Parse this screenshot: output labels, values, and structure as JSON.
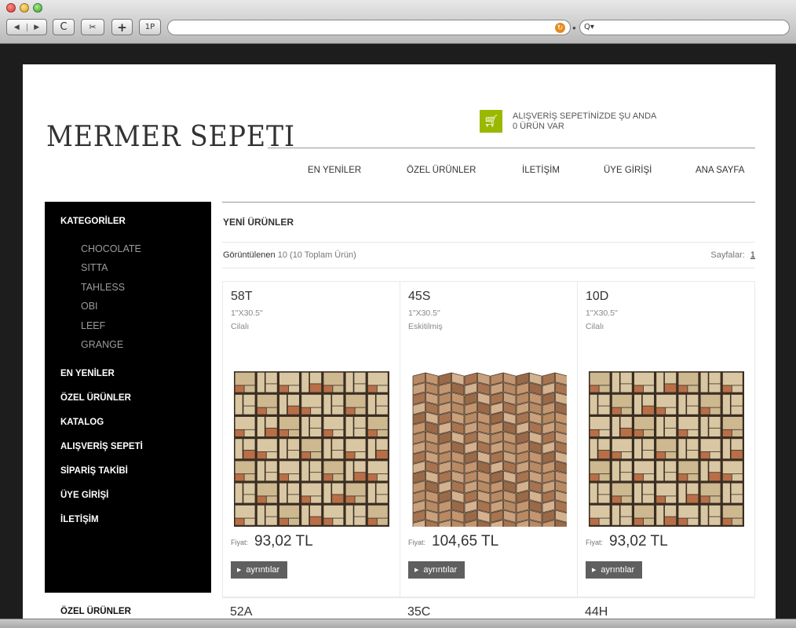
{
  "browser": {
    "back_label": "◀",
    "forward_label": "▶",
    "reload_label": "C",
    "snap_label": "✂",
    "add_label": "+",
    "onep_label": "1P",
    "search_placeholder": "Q▾"
  },
  "header": {
    "logo": "MERMER SEPETI",
    "cart_line1": "ALIŞVERİŞ SEPETİNİZDE ŞU ANDA",
    "cart_line2": "0 ÜRÜN VAR",
    "cart_icon": "shopping-cart-icon",
    "nav": [
      "EN YENİLER",
      "ÖZEL ÜRÜNLER",
      "İLETİŞİM",
      "ÜYE GİRİŞİ",
      "ANA SAYFA"
    ]
  },
  "sidebar": {
    "heading": "KATEGORİLER",
    "categories": [
      "CHOCOLATE",
      "SITTA",
      "TAHLESS",
      "OBI",
      "LEEF",
      "GRANGE"
    ],
    "links": [
      "EN YENİLER",
      "ÖZEL ÜRÜNLER",
      "KATALOG",
      "ALIŞVERİŞ SEPETİ",
      "SİPARİŞ TAKİBİ",
      "ÜYE GİRİŞİ",
      "İLETİŞİM"
    ],
    "bottom_heading": "ÖZEL ÜRÜNLER"
  },
  "main": {
    "title": "YENİ ÜRÜNLER",
    "listing_label": "Görüntülenen",
    "listing_value": "10 (10 Toplam Ürün)",
    "pages_label": "Sayfalar:",
    "page_number": "1",
    "products": [
      {
        "code": "58T",
        "size": "1\"X30.5\"",
        "finish": "Cilalı",
        "price_label": "Fiyat:",
        "price": "93,02 TL",
        "button": "ayrıntılar",
        "pattern": "basketweave"
      },
      {
        "code": "45S",
        "size": "1\"X30.5\"",
        "finish": "Eskitilmiş",
        "price_label": "Fiyat:",
        "price": "104,65 TL",
        "button": "ayrıntılar",
        "pattern": "chevron"
      },
      {
        "code": "10D",
        "size": "1\"X30.5\"",
        "finish": "Cilalı",
        "price_label": "Fiyat:",
        "price": "93,02 TL",
        "button": "ayrıntılar",
        "pattern": "basketweave"
      }
    ],
    "next_row_codes": [
      "52A",
      "35C",
      "44H"
    ]
  },
  "colors": {
    "cart_accent": "#9ab800",
    "sidebar_bg": "#000000",
    "button_bg": "#5f5f5f",
    "tile_beige": "#d9c7a3",
    "tile_rust": "#b86f48"
  }
}
